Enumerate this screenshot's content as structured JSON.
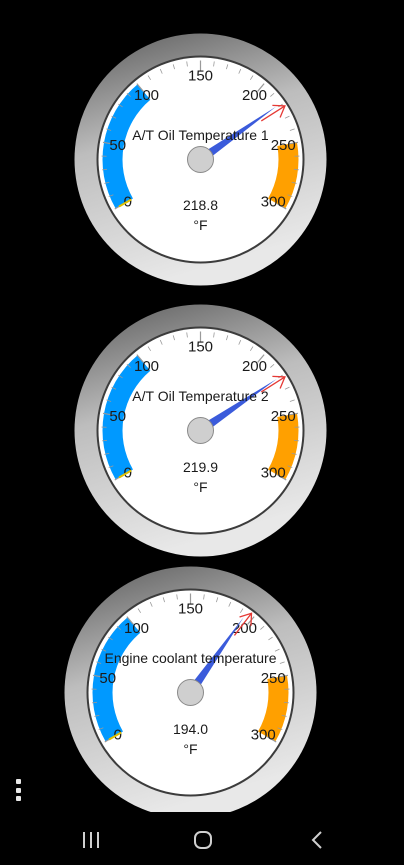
{
  "gauges": [
    {
      "title": "A/T Oil Temperature 1",
      "value": 218.8,
      "display_value": "218.8",
      "unit": "°F",
      "scale_labels": [
        "0",
        "50",
        "100",
        "150",
        "200",
        "250",
        "300"
      ],
      "scale_min": 0,
      "scale_max": 300,
      "previous_value": 222
    },
    {
      "title": "A/T Oil Temperature 2",
      "value": 219.9,
      "display_value": "219.9",
      "unit": "°F",
      "scale_labels": [
        "0",
        "50",
        "100",
        "150",
        "200",
        "250",
        "300"
      ],
      "scale_min": 0,
      "scale_max": 300,
      "previous_value": 222
    },
    {
      "title": "Engine coolant temperature",
      "value": 194.0,
      "display_value": "194.0",
      "unit": "°F",
      "scale_labels": [
        "0",
        "50",
        "100",
        "150",
        "200",
        "250",
        "300"
      ],
      "scale_min": 0,
      "scale_max": 300,
      "previous_value": 197
    }
  ],
  "zones": {
    "cold": {
      "from": 0,
      "to": 100,
      "color": "#0099ff"
    },
    "hot": {
      "from": 250,
      "to": 300,
      "color": "#ffa000"
    }
  },
  "colors": {
    "needle": "#3b5bdb",
    "max_marker": "#e53935",
    "min_marker": "#e0c000",
    "bezel": "#8a8a8a",
    "face": "#ffffff"
  },
  "icons": {
    "menu": "more-vert-icon",
    "recents": "recents-icon",
    "home": "home-icon",
    "back": "back-icon"
  }
}
